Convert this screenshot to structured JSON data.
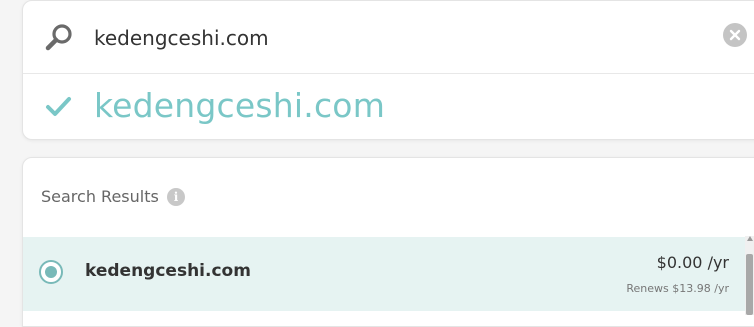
{
  "search": {
    "value": "kedengceshi.com",
    "icon": "search-icon",
    "clear_icon": "clear-icon"
  },
  "availability": {
    "status_icon": "check-icon",
    "domain": "kedengceshi.com",
    "accent_color": "#7ac7c7"
  },
  "results": {
    "title": "Search Results",
    "info_icon_glyph": "i",
    "items": [
      {
        "domain": "kedengceshi.com",
        "price": "$0.00 /yr",
        "renewal": "Renews $13.98 /yr",
        "selected": true,
        "highlight_color": "#e6f3f2"
      }
    ]
  }
}
